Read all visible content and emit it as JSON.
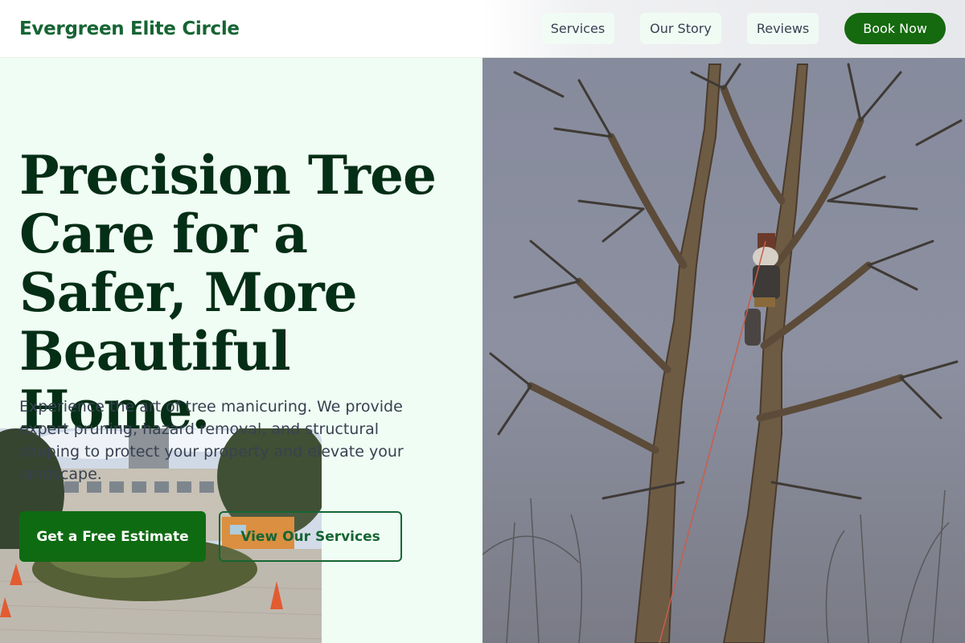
{
  "header": {
    "brand": "Evergreen Elite Circle",
    "nav": [
      "Services",
      "Our Story",
      "Reviews"
    ],
    "cta": "Book Now"
  },
  "hero": {
    "headline": "Precision Tree Care for a Safer, More Beautiful Home.",
    "lead": "Experience the art of tree manicuring. We provide expert pruning, hazard removal, and structural shaping to protect your property and elevate your landscape.",
    "primary_cta": "Get a Free Estimate",
    "secondary_cta": "View Our Services"
  },
  "colors": {
    "brand_green": "#166534",
    "button_green": "#0f6b12",
    "headline": "#052e16",
    "background": "#f0fdf4"
  }
}
